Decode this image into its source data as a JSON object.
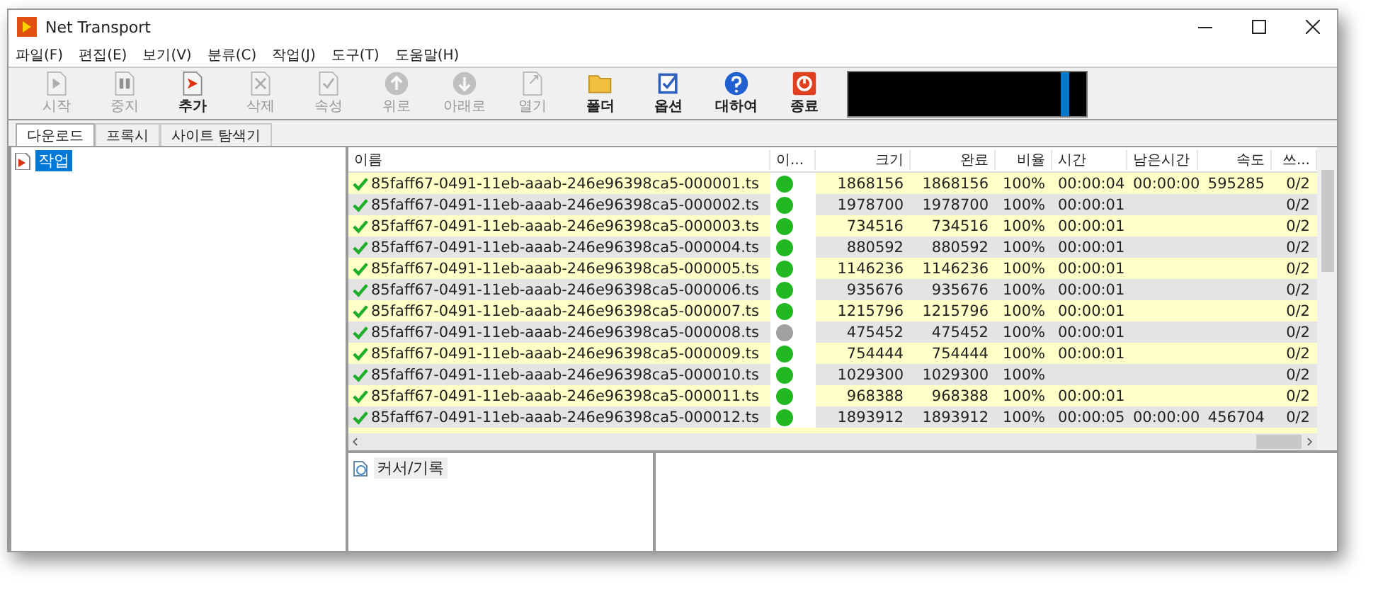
{
  "window": {
    "title": "Net Transport"
  },
  "menu": [
    "파일(F)",
    "편집(E)",
    "보기(V)",
    "분류(C)",
    "작업(J)",
    "도구(T)",
    "도움말(H)"
  ],
  "toolbar": [
    {
      "kind": "start",
      "label": "시작",
      "disabled": true
    },
    {
      "kind": "stop",
      "label": "중지",
      "disabled": true
    },
    {
      "kind": "add",
      "label": "추가",
      "disabled": false
    },
    {
      "kind": "delete",
      "label": "삭제",
      "disabled": true
    },
    {
      "kind": "properties",
      "label": "속성",
      "disabled": true
    },
    {
      "kind": "up",
      "label": "위로",
      "disabled": true
    },
    {
      "kind": "down",
      "label": "아래로",
      "disabled": true
    },
    {
      "kind": "open",
      "label": "열기",
      "disabled": true
    },
    {
      "kind": "folder",
      "label": "폴더",
      "disabled": false
    },
    {
      "kind": "options",
      "label": "옵션",
      "disabled": false
    },
    {
      "kind": "about",
      "label": "대하여",
      "disabled": false
    },
    {
      "kind": "exit",
      "label": "종료",
      "disabled": false
    }
  ],
  "tabs": [
    {
      "label": "다운로드",
      "selected": true
    },
    {
      "label": "프록시",
      "selected": false
    },
    {
      "label": "사이트 탐색기",
      "selected": false
    }
  ],
  "tree": [
    {
      "label": "작업",
      "selected": true
    }
  ],
  "table": {
    "columns": [
      "이름",
      "이...",
      "크기",
      "완료",
      "비율",
      "시간",
      "남은시간",
      "속도",
      "쓰..."
    ],
    "rows": [
      {
        "name": "85faff67-0491-11eb-aaab-246e96398ca5-000001.ts",
        "color": "#22b822",
        "size": "1868156",
        "done": "1868156",
        "ratio": "100%",
        "time": "00:00:04",
        "remaining": "00:00:00",
        "speed": "595285",
        "threads": "0/2"
      },
      {
        "name": "85faff67-0491-11eb-aaab-246e96398ca5-000002.ts",
        "color": "#22b822",
        "size": "1978700",
        "done": "1978700",
        "ratio": "100%",
        "time": "00:00:01",
        "threads": "0/2"
      },
      {
        "name": "85faff67-0491-11eb-aaab-246e96398ca5-000003.ts",
        "color": "#22b822",
        "size": "734516",
        "done": "734516",
        "ratio": "100%",
        "time": "00:00:01",
        "threads": "0/2"
      },
      {
        "name": "85faff67-0491-11eb-aaab-246e96398ca5-000004.ts",
        "color": "#22b822",
        "size": "880592",
        "done": "880592",
        "ratio": "100%",
        "time": "00:00:01",
        "threads": "0/2"
      },
      {
        "name": "85faff67-0491-11eb-aaab-246e96398ca5-000005.ts",
        "color": "#22b822",
        "size": "1146236",
        "done": "1146236",
        "ratio": "100%",
        "time": "00:00:01",
        "threads": "0/2"
      },
      {
        "name": "85faff67-0491-11eb-aaab-246e96398ca5-000006.ts",
        "color": "#22b822",
        "size": "935676",
        "done": "935676",
        "ratio": "100%",
        "time": "00:00:01",
        "threads": "0/2"
      },
      {
        "name": "85faff67-0491-11eb-aaab-246e96398ca5-000007.ts",
        "color": "#22b822",
        "size": "1215796",
        "done": "1215796",
        "ratio": "100%",
        "time": "00:00:01",
        "threads": "0/2"
      },
      {
        "name": "85faff67-0491-11eb-aaab-246e96398ca5-000008.ts",
        "color": "#a0a0a0",
        "size": "475452",
        "done": "475452",
        "ratio": "100%",
        "time": "00:00:01",
        "threads": "0/2"
      },
      {
        "name": "85faff67-0491-11eb-aaab-246e96398ca5-000009.ts",
        "color": "#22b822",
        "size": "754444",
        "done": "754444",
        "ratio": "100%",
        "time": "00:00:01",
        "threads": "0/2"
      },
      {
        "name": "85faff67-0491-11eb-aaab-246e96398ca5-000010.ts",
        "color": "#22b822",
        "size": "1029300",
        "done": "1029300",
        "ratio": "100%",
        "threads": "0/2"
      },
      {
        "name": "85faff67-0491-11eb-aaab-246e96398ca5-000011.ts",
        "color": "#22b822",
        "size": "968388",
        "done": "968388",
        "ratio": "100%",
        "time": "00:00:01",
        "threads": "0/2"
      },
      {
        "name": "85faff67-0491-11eb-aaab-246e96398ca5-000012.ts",
        "color": "#22b822",
        "size": "1893912",
        "done": "1893912",
        "ratio": "100%",
        "time": "00:00:05",
        "remaining": "00:00:00",
        "speed": "456704",
        "threads": "0/2"
      }
    ]
  },
  "log_panel": {
    "label": "커서/기록"
  }
}
